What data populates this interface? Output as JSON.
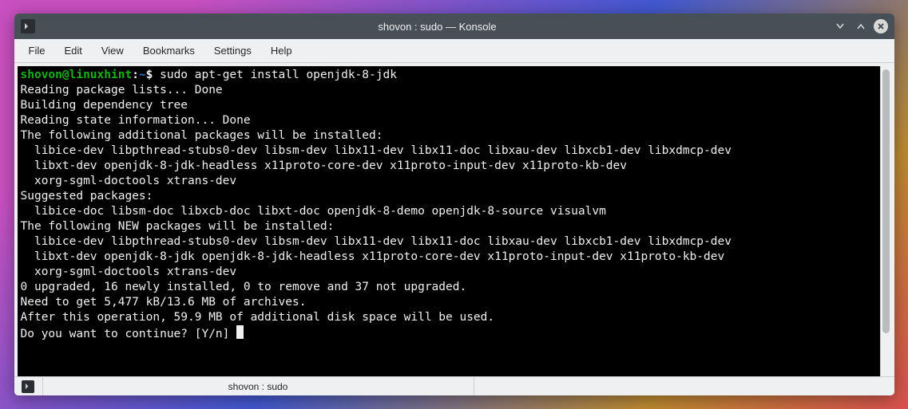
{
  "window": {
    "title": "shovon : sudo — Konsole"
  },
  "menubar": {
    "items": [
      "File",
      "Edit",
      "View",
      "Bookmarks",
      "Settings",
      "Help"
    ]
  },
  "tab": {
    "label": "shovon : sudo"
  },
  "prompt": {
    "user_host": "shovon@linuxhint",
    "colon": ":",
    "path": "~",
    "symbol": "$",
    "command": " sudo apt-get install openjdk-8-jdk"
  },
  "lines": {
    "l1": "Reading package lists... Done",
    "l2": "Building dependency tree       ",
    "l3": "Reading state information... Done",
    "l4": "The following additional packages will be installed:",
    "l5": "  libice-dev libpthread-stubs0-dev libsm-dev libx11-dev libx11-doc libxau-dev libxcb1-dev libxdmcp-dev",
    "l6": "  libxt-dev openjdk-8-jdk-headless x11proto-core-dev x11proto-input-dev x11proto-kb-dev",
    "l7": "  xorg-sgml-doctools xtrans-dev",
    "l8": "Suggested packages:",
    "l9": "  libice-doc libsm-doc libxcb-doc libxt-doc openjdk-8-demo openjdk-8-source visualvm",
    "l10": "The following NEW packages will be installed:",
    "l11": "  libice-dev libpthread-stubs0-dev libsm-dev libx11-dev libx11-doc libxau-dev libxcb1-dev libxdmcp-dev",
    "l12": "  libxt-dev openjdk-8-jdk openjdk-8-jdk-headless x11proto-core-dev x11proto-input-dev x11proto-kb-dev",
    "l13": "  xorg-sgml-doctools xtrans-dev",
    "l14": "0 upgraded, 16 newly installed, 0 to remove and 37 not upgraded.",
    "l15": "Need to get 5,477 kB/13.6 MB of archives.",
    "l16": "After this operation, 59.9 MB of additional disk space will be used.",
    "l17": "Do you want to continue? [Y/n] "
  }
}
